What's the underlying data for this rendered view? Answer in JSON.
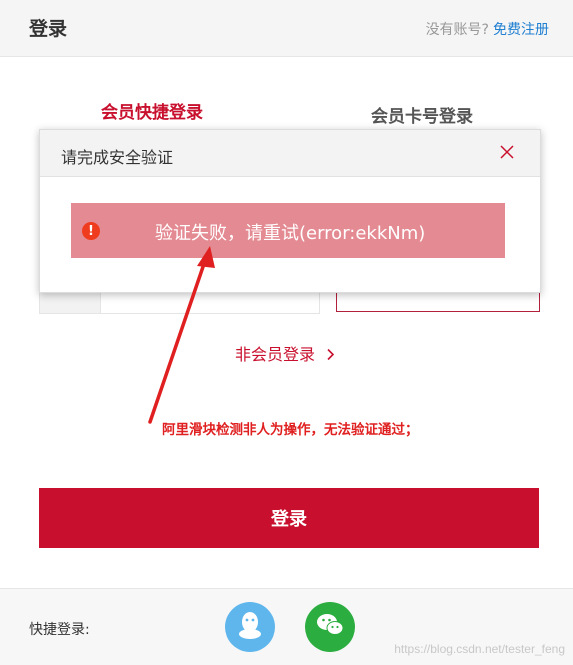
{
  "header": {
    "title": "登录",
    "no_account": "没有账号?",
    "register_link": "免费注册"
  },
  "tabs": {
    "fast_login": "会员快捷登录",
    "card_login": "会员卡号登录"
  },
  "nonmember_login": "非会员登录",
  "annotation": "阿里滑块检测非人为操作，无法验证通过；",
  "login_button": "登录",
  "footer": {
    "quick_login_label": "快捷登录:",
    "watermark": "https://blog.csdn.net/tester_feng"
  },
  "modal": {
    "title": "请完成安全验证",
    "error_message": "验证失败，请重试(error:ekkNm)"
  },
  "icons": {
    "close": "close-icon",
    "error": "error-icon",
    "qq": "qq-icon",
    "wechat": "wechat-icon",
    "chevron": "chevron-right-icon"
  },
  "colors": {
    "brand_red": "#c8102e",
    "link_blue": "#1f7fd1",
    "error_bar": "#e48a92",
    "annotation_red": "#e02020",
    "qq_blue": "#5fb6ec",
    "wechat_green": "#2bad3f"
  }
}
